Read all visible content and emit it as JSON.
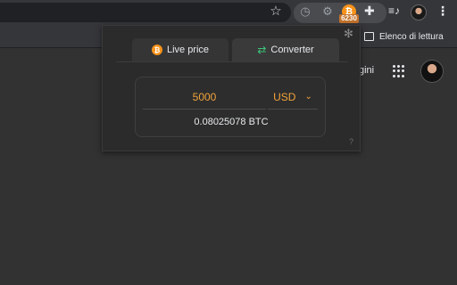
{
  "toolbar": {
    "star_icon": "star-icon",
    "badge": "6230",
    "btc_ext_symbol": "₿"
  },
  "bookmarks": {
    "reading_list": "Elenco di lettura"
  },
  "page": {
    "partial_text": "gini"
  },
  "popup": {
    "tabs": [
      {
        "label": "Live price",
        "icon": "bitcoin-icon"
      },
      {
        "label": "Converter",
        "icon": "convert-icon"
      }
    ],
    "coin_symbol": "₿",
    "converter": {
      "amount": "5000",
      "currency": "USD",
      "result": "0.08025078 BTC"
    },
    "help": "?"
  },
  "colors": {
    "accent": "#f2a33a",
    "bitcoin": "#f7931a",
    "green": "#3ec47a"
  }
}
